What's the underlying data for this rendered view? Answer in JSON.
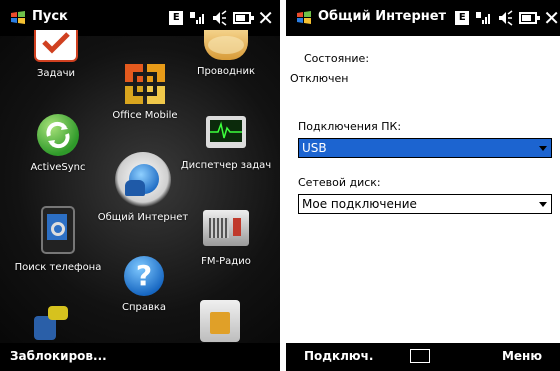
{
  "left": {
    "title": "Пуск",
    "status_letter": "E",
    "items": [
      {
        "label": "Задачи",
        "icon": "tasks-icon"
      },
      {
        "label": "Проводник",
        "icon": "explorer-icon"
      },
      {
        "label": "Office Mobile",
        "icon": "office-mobile-icon"
      },
      {
        "label": "ActiveSync",
        "icon": "activesync-icon"
      },
      {
        "label": "Диспетчер задач",
        "icon": "task-manager-icon"
      },
      {
        "label": "Общий Интернет",
        "icon": "internet-sharing-icon"
      },
      {
        "label": "Поиск телефона",
        "icon": "phone-search-icon"
      },
      {
        "label": "FM-Радио",
        "icon": "fm-radio-icon"
      },
      {
        "label": "Справка",
        "icon": "help-icon"
      }
    ],
    "softkey_left": "Заблокиров..."
  },
  "right": {
    "title": "Общий Интернет",
    "status_letter": "E",
    "state_label": "Состояние:",
    "state_value": "Отключен",
    "pc_connection_label": "Подключения ПК:",
    "pc_connection_value": "USB",
    "network_label": "Сетевой диск:",
    "network_value": "Мое подключение",
    "softkey_left": "Подключ.",
    "softkey_right": "Меню"
  },
  "colors": {
    "selection": "#1c64d0",
    "bar": "#000000"
  }
}
